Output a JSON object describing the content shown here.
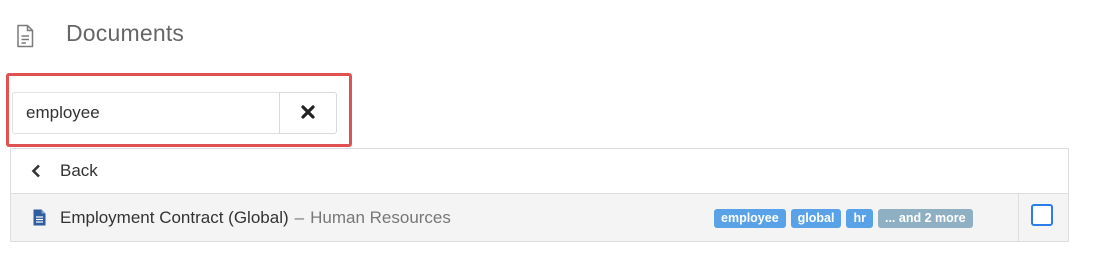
{
  "header": {
    "title": "Documents",
    "icon": "document-icon"
  },
  "search": {
    "value": "employee",
    "placeholder": "",
    "clear_icon": "close-icon"
  },
  "list": {
    "back_label": "Back",
    "back_icon": "chevron-left-icon",
    "rows": [
      {
        "icon": "file-text-icon",
        "title": "Employment Contract (Global)",
        "separator": "–",
        "category": "Human Resources",
        "tags": [
          "employee",
          "global",
          "hr"
        ],
        "more_tag": "... and 2 more"
      }
    ]
  },
  "colors": {
    "accent": "#2b7de9",
    "tag": "#5aa2e8",
    "tag_more": "#8fb0c2",
    "highlight": "#e05252"
  }
}
